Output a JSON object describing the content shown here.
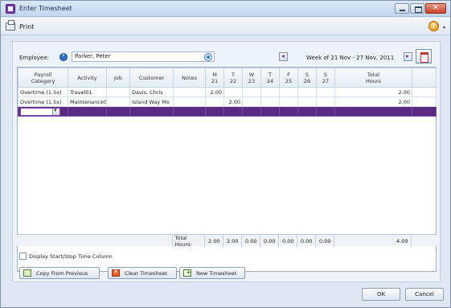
{
  "window": {
    "title": "Enter Timesheet"
  },
  "toolbar": {
    "print_label": "Print",
    "help_icon": "help-icon"
  },
  "employee": {
    "label": "Employee:",
    "value": "Parker, Peter"
  },
  "week": {
    "label": "Week of 21 Nov - 27 Nov, 2011"
  },
  "columns": [
    {
      "line1": "Payroll",
      "line2": "Category"
    },
    {
      "line1": "Activity",
      "line2": ""
    },
    {
      "line1": "Job",
      "line2": ""
    },
    {
      "line1": "Customer",
      "line2": ""
    },
    {
      "line1": "Notes",
      "line2": ""
    },
    {
      "line1": "M",
      "line2": "21"
    },
    {
      "line1": "T",
      "line2": "22"
    },
    {
      "line1": "W",
      "line2": "23"
    },
    {
      "line1": "T",
      "line2": "24"
    },
    {
      "line1": "F",
      "line2": "25"
    },
    {
      "line1": "S",
      "line2": "26"
    },
    {
      "line1": "S",
      "line2": "27"
    },
    {
      "line1": "Total",
      "line2": "Hours"
    }
  ],
  "rows": [
    {
      "category": "Overtime (1.5x)",
      "activity": "Travel01",
      "job": "",
      "customer": "Davis, Chris",
      "notes": "",
      "mon": "2.00",
      "tue": "",
      "wed": "",
      "thu": "",
      "fri": "",
      "sat": "",
      "sun": "",
      "total": "2.00"
    },
    {
      "category": "Overtime (1.5x)",
      "activity": "Maintenance0",
      "job": "",
      "customer": "Island Way Mo",
      "notes": "",
      "mon": "",
      "tue": "2.00",
      "wed": "",
      "thu": "",
      "fri": "",
      "sat": "",
      "sun": "",
      "total": "2.00"
    }
  ],
  "totals": {
    "label": "Total Hours:",
    "mon": "2.00",
    "tue": "2.00",
    "wed": "0.00",
    "thu": "0.00",
    "fri": "0.00",
    "sat": "0.00",
    "sun": "0.00",
    "total": "4.00"
  },
  "options": {
    "start_stop_label": "Display Start/Stop Time Column"
  },
  "actions": {
    "copy_label": "Copy From Previous",
    "clear_label": "Clear Timesheet",
    "new_label": "New Timesheet"
  },
  "footer": {
    "ok_label": "OK",
    "cancel_label": "Cancel"
  }
}
